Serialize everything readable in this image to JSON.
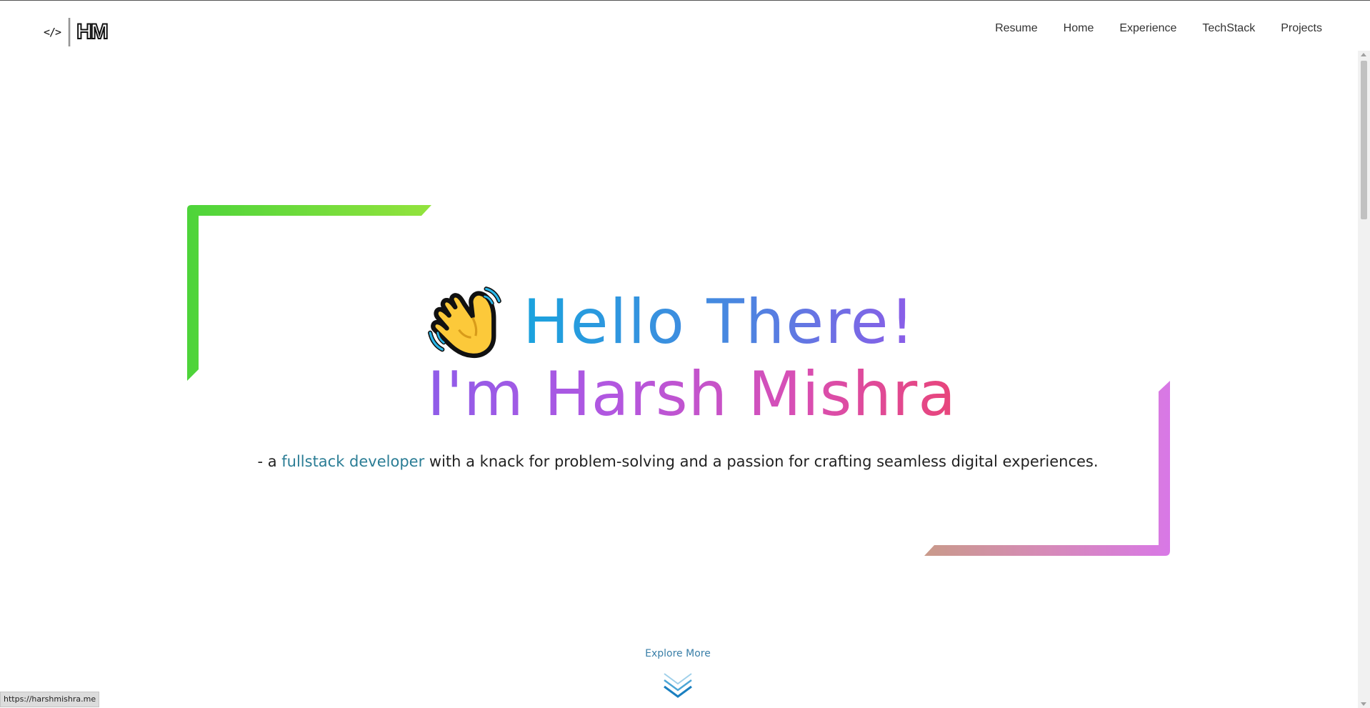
{
  "header": {
    "logo_code": "</>",
    "logo_text": "HM",
    "nav": [
      "Resume",
      "Home",
      "Experience",
      "TechStack",
      "Projects"
    ]
  },
  "hero": {
    "greeting": "Hello There!",
    "name": "I'm Harsh Mishra",
    "tagline_prefix": "- a ",
    "tagline_highlight": "fullstack developer",
    "tagline_suffix": " with a knack for problem-solving and a passion for crafting seamless digital experiences.",
    "wave_icon": "waving-hand-icon"
  },
  "explore": {
    "label": "Explore More",
    "icon": "double-chevron-down-icon"
  },
  "status_bar": {
    "url": "https://harshmishra.me"
  },
  "colors": {
    "frame_green": "#4dd43a",
    "frame_pink": "#d878e6",
    "greeting_start": "#1aa3de",
    "name_end": "#e8457a",
    "highlight": "#2b7d95",
    "explore": "#3a7fa8"
  }
}
